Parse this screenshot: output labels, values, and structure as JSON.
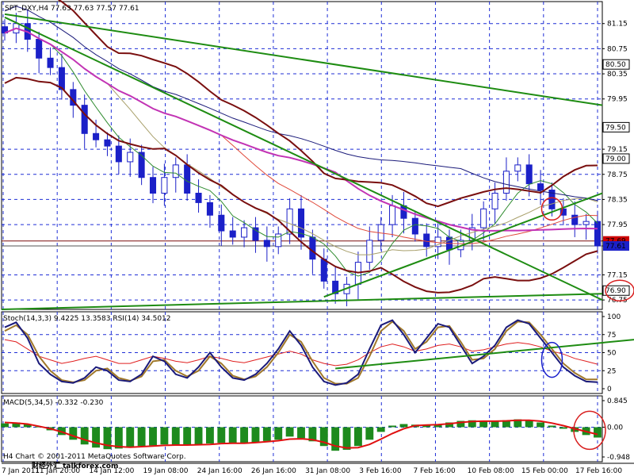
{
  "colors": {
    "background": "#ffffff",
    "grid": "#1f2fd6",
    "candles": "#1b20c8",
    "trendlines": "#1e8c12",
    "bollinger": "#7a0f0f",
    "ma_magenta": "#c233b4",
    "ma_navy": "#1b1b7a",
    "ma_red": "#e0493a",
    "ma_olive": "#a89f6a",
    "ma_green": "#2e8b2e",
    "stoch_main": "#1a1a7a",
    "stoch_signal": "#a0782a",
    "rsi": "#e02020",
    "ao_up": "#1d8a1d",
    "ao_down": "#1d8a1d",
    "ao_line": "#e01010",
    "highlight_box": "#cc0000",
    "current_box": "#1b20c8",
    "annotation_red": "#d81e1e",
    "annotation_blue": "#1a20cc"
  },
  "chart_data": [
    {
      "type": "candlestick",
      "title": "SPT_DXY,H4  77.63 77.63 77.57 77.61",
      "ylim": [
        76.6,
        81.5
      ],
      "y_ticks": [
        "81.15",
        "80.75",
        "80.50",
        "80.35",
        "79.95",
        "79.50",
        "79.15",
        "79.00",
        "78.75",
        "78.35",
        "77.95",
        "77.69",
        "77.61",
        "77.15",
        "76.90",
        "76.75"
      ],
      "y_tick_values": [
        81.15,
        80.75,
        80.5,
        80.35,
        79.95,
        79.5,
        79.15,
        79.0,
        78.75,
        78.35,
        77.95,
        77.69,
        77.61,
        77.15,
        76.9,
        76.75
      ],
      "highlighted_levels": [
        "80.50",
        "79.50",
        "79.00",
        "77.69",
        "77.61",
        "76.90"
      ],
      "x_ticks": [
        "7 Jan 2011",
        "11 Jan 20:00",
        "14 Jan 12:00",
        "19 Jan 08:00",
        "24 Jan 16:00",
        "26 Jan 16:00",
        "31 Jan 08:00",
        "3 Feb 16:00",
        "7 Feb 16:00",
        "10 Feb 08:00",
        "15 Feb 00:00",
        "17 Feb 16:00"
      ],
      "close_path": [
        81.0,
        81.15,
        80.9,
        80.6,
        80.45,
        80.1,
        79.85,
        79.4,
        79.3,
        79.2,
        78.95,
        79.1,
        78.7,
        78.45,
        78.7,
        78.9,
        78.45,
        78.3,
        78.1,
        77.85,
        77.75,
        77.9,
        77.7,
        77.6,
        77.8,
        78.2,
        77.75,
        77.4,
        77.05,
        76.85,
        77.0,
        77.35,
        77.7,
        77.95,
        78.25,
        78.05,
        77.8,
        77.6,
        77.75,
        77.55,
        77.7,
        77.9,
        78.2,
        78.45,
        78.8,
        78.9,
        78.6,
        78.5,
        78.2,
        78.1,
        77.95,
        78.0,
        77.61
      ],
      "current_price": "77.61",
      "ref_price": "77.69"
    },
    {
      "type": "line",
      "title": "Stoch(14,3,3) 9.4225 13.3583  RSI(14) 34.5012",
      "ylim": [
        0,
        100
      ],
      "y_ticks": [
        "100",
        "75",
        "50",
        "25",
        "0"
      ],
      "y_tick_values": [
        100,
        75,
        50,
        25,
        0
      ],
      "series": [
        {
          "name": "Stoch main",
          "values": [
            85,
            92,
            70,
            35,
            20,
            10,
            8,
            15,
            30,
            25,
            12,
            10,
            20,
            45,
            38,
            20,
            15,
            30,
            50,
            30,
            15,
            12,
            20,
            35,
            55,
            80,
            60,
            30,
            10,
            5,
            8,
            20,
            55,
            88,
            95,
            75,
            50,
            70,
            90,
            85,
            60,
            35,
            45,
            60,
            85,
            95,
            90,
            70,
            50,
            30,
            18,
            10,
            9
          ]
        },
        {
          "name": "Stoch signal",
          "values": [
            80,
            88,
            75,
            45,
            25,
            12,
            9,
            12,
            25,
            28,
            15,
            11,
            17,
            38,
            40,
            25,
            17,
            25,
            45,
            35,
            18,
            13,
            17,
            30,
            50,
            75,
            65,
            38,
            15,
            7,
            7,
            15,
            45,
            80,
            93,
            80,
            55,
            65,
            85,
            87,
            65,
            40,
            42,
            55,
            80,
            93,
            92,
            75,
            55,
            35,
            22,
            13,
            13
          ]
        },
        {
          "name": "RSI",
          "values": [
            68,
            65,
            55,
            45,
            40,
            35,
            38,
            42,
            45,
            40,
            35,
            35,
            40,
            45,
            42,
            38,
            36,
            40,
            45,
            42,
            38,
            36,
            40,
            44,
            48,
            52,
            48,
            40,
            35,
            32,
            34,
            40,
            50,
            58,
            62,
            58,
            52,
            55,
            60,
            62,
            58,
            52,
            54,
            58,
            62,
            64,
            62,
            58,
            52,
            48,
            42,
            38,
            34
          ]
        }
      ]
    },
    {
      "type": "bar",
      "title": "MACD(5,34,5) -0.332 -0.230",
      "ylim": [
        -0.948,
        0.845
      ],
      "y_ticks": [
        "0.845",
        "0.00",
        "-0.948"
      ],
      "y_tick_values": [
        0.845,
        0.0,
        -0.948
      ],
      "values": [
        0.12,
        0.15,
        0.1,
        0.02,
        -0.1,
        -0.25,
        -0.4,
        -0.55,
        -0.65,
        -0.7,
        -0.68,
        -0.65,
        -0.6,
        -0.58,
        -0.55,
        -0.56,
        -0.58,
        -0.55,
        -0.52,
        -0.5,
        -0.5,
        -0.52,
        -0.48,
        -0.44,
        -0.4,
        -0.3,
        -0.35,
        -0.45,
        -0.6,
        -0.75,
        -0.72,
        -0.6,
        -0.4,
        -0.15,
        0.05,
        0.1,
        0.08,
        0.05,
        0.1,
        0.15,
        0.2,
        0.22,
        0.2,
        0.18,
        0.22,
        0.25,
        0.22,
        0.15,
        0.05,
        -0.05,
        -0.15,
        -0.25,
        -0.33
      ],
      "signal": [
        0.15,
        0.13,
        0.1,
        0.03,
        -0.05,
        -0.15,
        -0.28,
        -0.4,
        -0.5,
        -0.58,
        -0.62,
        -0.64,
        -0.62,
        -0.6,
        -0.58,
        -0.57,
        -0.57,
        -0.56,
        -0.55,
        -0.52,
        -0.51,
        -0.51,
        -0.49,
        -0.46,
        -0.43,
        -0.38,
        -0.37,
        -0.4,
        -0.48,
        -0.6,
        -0.66,
        -0.65,
        -0.55,
        -0.38,
        -0.2,
        -0.05,
        0.05,
        0.07,
        0.08,
        0.11,
        0.15,
        0.18,
        0.19,
        0.19,
        0.2,
        0.22,
        0.22,
        0.19,
        0.13,
        0.05,
        -0.05,
        -0.14,
        -0.23
      ],
      "legend_overlay": "H4 Chart © 2001-2011 MetaQuotes Software Corp.",
      "watermark": "财经外汇 talkforex.com"
    }
  ]
}
